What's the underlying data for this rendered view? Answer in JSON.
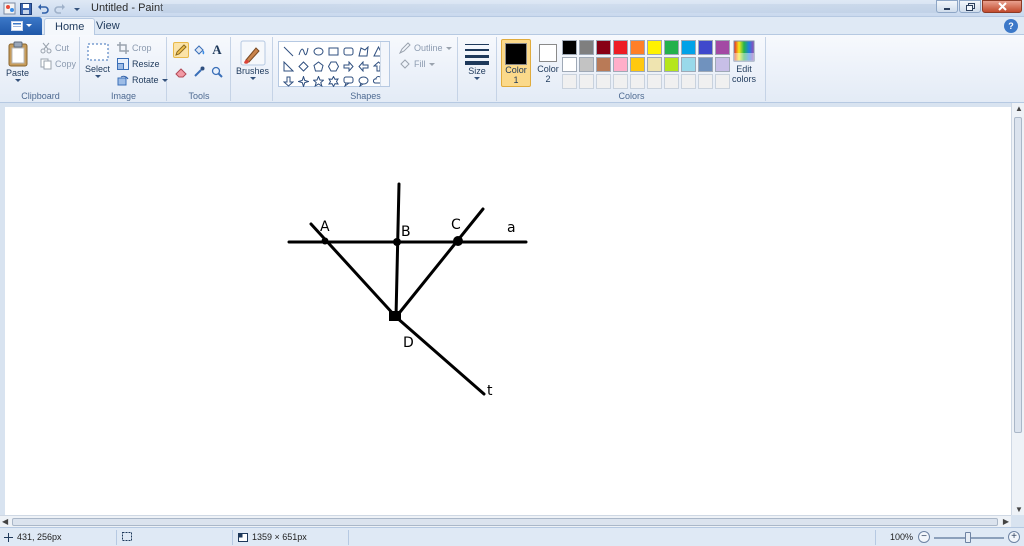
{
  "window": {
    "title": "Untitled - Paint",
    "icons": [
      "paint-app-icon",
      "save-icon",
      "undo-icon",
      "redo-icon",
      "qat-dropdown-icon",
      "minimize-icon",
      "maximize-icon",
      "close-icon"
    ]
  },
  "tabs": [
    {
      "label": "Home",
      "active": true
    },
    {
      "label": "View",
      "active": false
    }
  ],
  "ribbon": {
    "clipboard": {
      "group_label": "Clipboard",
      "paste": "Paste",
      "cut": "Cut",
      "copy": "Copy"
    },
    "image": {
      "group_label": "Image",
      "select": "Select",
      "crop": "Crop",
      "resize": "Resize",
      "rotate": "Rotate"
    },
    "tools": {
      "group_label": "Tools",
      "items": [
        "pencil-icon",
        "fill-icon",
        "text-icon",
        "eraser-icon",
        "color-picker-icon",
        "magnifier-icon"
      ],
      "text_glyph": "A"
    },
    "brushes": {
      "label": "Brushes"
    },
    "shapes": {
      "group_label": "Shapes",
      "outline": "Outline",
      "fill": "Fill"
    },
    "size": {
      "label": "Size"
    },
    "colors": {
      "group_label": "Colors",
      "color1_label": "Color",
      "color1_num": "1",
      "color1_value": "#000000",
      "color2_label": "Color",
      "color2_num": "2",
      "color2_value": "#ffffff",
      "edit_label": "Edit",
      "edit_label2": "colors",
      "palette_row1": [
        "#000000",
        "#7f7f7f",
        "#880015",
        "#ed1c24",
        "#ff7f27",
        "#fff200",
        "#22b14c",
        "#00a2e8",
        "#3f48cc",
        "#a349a4"
      ],
      "palette_row2": [
        "#ffffff",
        "#c3c3c3",
        "#b97a57",
        "#ffaec9",
        "#ffc90e",
        "#efe4b0",
        "#b5e61d",
        "#99d9ea",
        "#7092be",
        "#c8bfe7"
      ],
      "palette_row3": [
        "#f0f0f0",
        "#f0f0f0",
        "#f0f0f0",
        "#f0f0f0",
        "#f0f0f0",
        "#f0f0f0",
        "#f0f0f0",
        "#f0f0f0",
        "#f0f0f0",
        "#f0f0f0"
      ]
    }
  },
  "drawing": {
    "labels": {
      "A": "A",
      "B": "B",
      "C": "C",
      "D": "D",
      "a": "a",
      "t": "t"
    }
  },
  "status": {
    "cursor_pos": "431, 256px",
    "canvas_size": "1359 × 651px",
    "zoom": "100%"
  }
}
